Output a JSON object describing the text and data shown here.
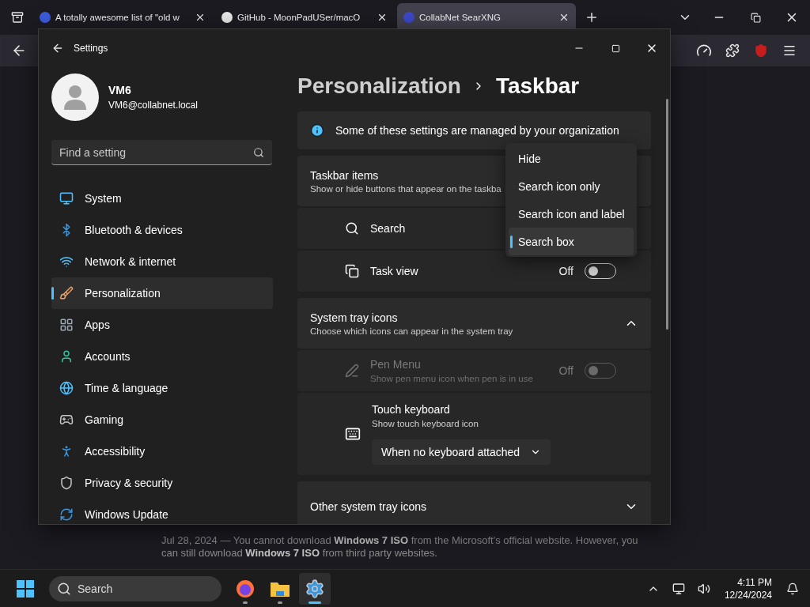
{
  "browser": {
    "tabs": [
      {
        "title": "A totally awesome list of \"old w",
        "selected": false
      },
      {
        "title": "GitHub - MoonPadUSer/macO",
        "selected": false
      },
      {
        "title": "CollabNet SearXNG",
        "selected": true
      }
    ]
  },
  "page": {
    "snippet": "Jul 28, 2024 — You cannot download **Windows 7 ISO** from the Microsoft's official website. However, you can still download **Windows 7 ISO** from third party websites."
  },
  "settings": {
    "title": "Settings",
    "user": {
      "name": "VM6",
      "email": "VM6@collabnet.local"
    },
    "search": {
      "placeholder": "Find a setting"
    },
    "nav": [
      {
        "label": "System",
        "selected": false
      },
      {
        "label": "Bluetooth & devices",
        "selected": false
      },
      {
        "label": "Network & internet",
        "selected": false
      },
      {
        "label": "Personalization",
        "selected": true
      },
      {
        "label": "Apps",
        "selected": false
      },
      {
        "label": "Accounts",
        "selected": false
      },
      {
        "label": "Time & language",
        "selected": false
      },
      {
        "label": "Gaming",
        "selected": false
      },
      {
        "label": "Accessibility",
        "selected": false
      },
      {
        "label": "Privacy & security",
        "selected": false
      },
      {
        "label": "Windows Update",
        "selected": false
      }
    ],
    "breadcrumb": {
      "parent": "Personalization",
      "current": "Taskbar"
    },
    "banner": "Some of these settings are managed by your organization",
    "sections": [
      {
        "title": "Taskbar items",
        "subtitle": "Show or hide buttons that appear on the taskba",
        "rows": [
          {
            "kind": "menu",
            "label": "Search"
          },
          {
            "kind": "toggle",
            "label": "Task view",
            "on": false,
            "state": "Off",
            "disabled": false
          }
        ]
      },
      {
        "title": "System tray icons",
        "subtitle": "Choose which icons can appear in the system tray",
        "expanded": true,
        "rows": [
          {
            "kind": "toggle",
            "label": "Pen Menu",
            "subtitle": "Show pen menu icon when pen is in use",
            "on": false,
            "state": "Off",
            "disabled": true
          },
          {
            "kind": "select",
            "label": "Touch keyboard",
            "subtitle": "Show touch keyboard icon",
            "value": "When no keyboard attached"
          }
        ]
      },
      {
        "title": "Other system tray icons",
        "expanded": false
      }
    ],
    "menu": {
      "options": [
        {
          "label": "Hide",
          "selected": false
        },
        {
          "label": "Search icon only",
          "selected": false
        },
        {
          "label": "Search icon and label",
          "selected": false
        },
        {
          "label": "Search box",
          "selected": true
        }
      ]
    }
  },
  "taskbar": {
    "search": {
      "placeholder": "Search"
    },
    "apps": [
      {
        "kind": "browser",
        "active": false
      },
      {
        "kind": "folder",
        "active": false
      },
      {
        "kind": "settings",
        "active": true
      }
    ],
    "time": "4:11 PM",
    "date": "12/24/2024"
  }
}
